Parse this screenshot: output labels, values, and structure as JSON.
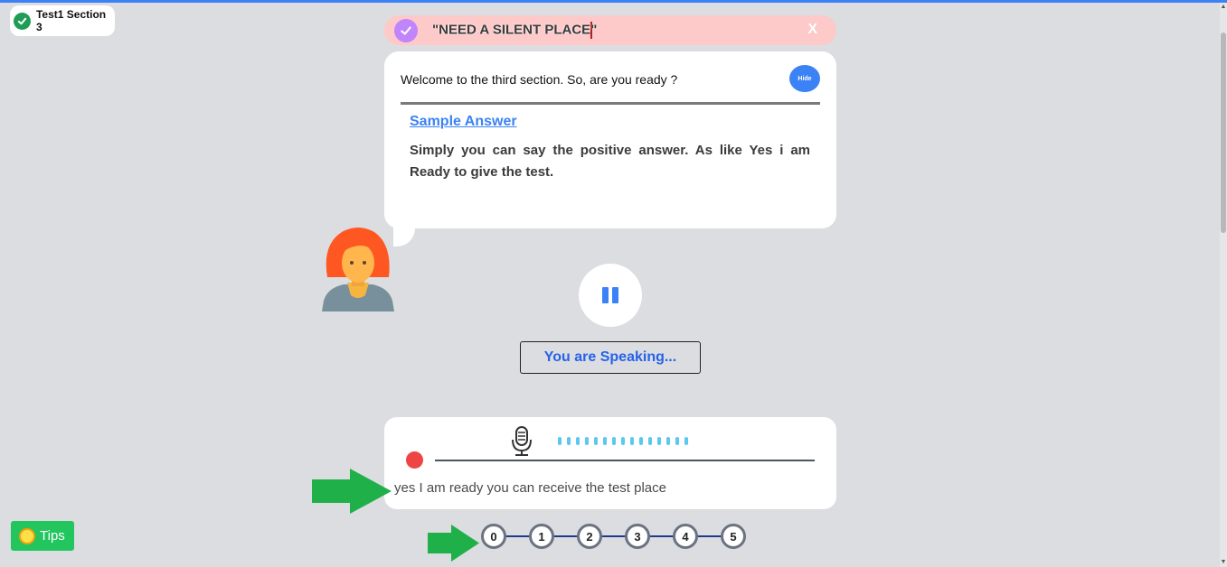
{
  "section_badge": {
    "label": "Test1 Section 3"
  },
  "alert": {
    "text_before_cursor": "\"NEED A SILENT PLACE",
    "text_after_cursor": "\"",
    "close_label": "X"
  },
  "question_card": {
    "question": "Welcome to the third section. So, are you ready ?",
    "hide_label": "Hide",
    "sample_link": "Sample Answer",
    "sample_answer": "Simply you can say the positive answer. As like Yes i am Ready to give the test."
  },
  "status": {
    "speaking_text": "You are Speaking..."
  },
  "transcript": {
    "text": "yes I am ready you can receive the test place"
  },
  "steps": [
    "0",
    "1",
    "2",
    "3",
    "4",
    "5"
  ],
  "tips": {
    "label": "Tips"
  },
  "colors": {
    "accent": "#3b82f6",
    "alert_bg": "#fdc9c9",
    "record": "#ef4444",
    "tips": "#22c55e",
    "arrow": "#20b049"
  }
}
